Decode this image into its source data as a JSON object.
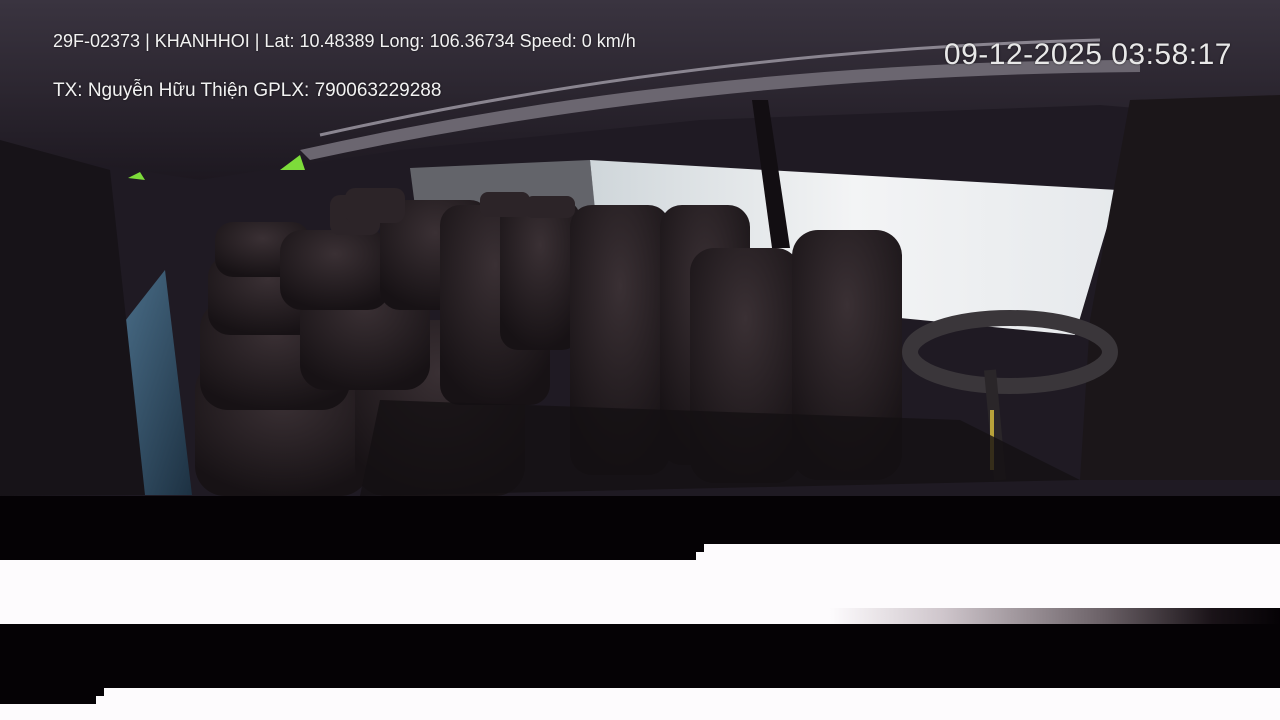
{
  "osd": {
    "line1": "29F-02373 | KHANHHOI | Lat: 10.48389 Long: 106.36734 Speed: 0 km/h",
    "line2": "TX: Nguyễn Hữu Thiện GPLX: 790063229288",
    "timestamp": "09-12-2025 03:58:17"
  },
  "scene": {
    "description_colors": {
      "interior": "#1f1a23",
      "window_light": "#e8ecef",
      "seat": "#2a2226",
      "accent_green": "#7ddc3a"
    }
  }
}
